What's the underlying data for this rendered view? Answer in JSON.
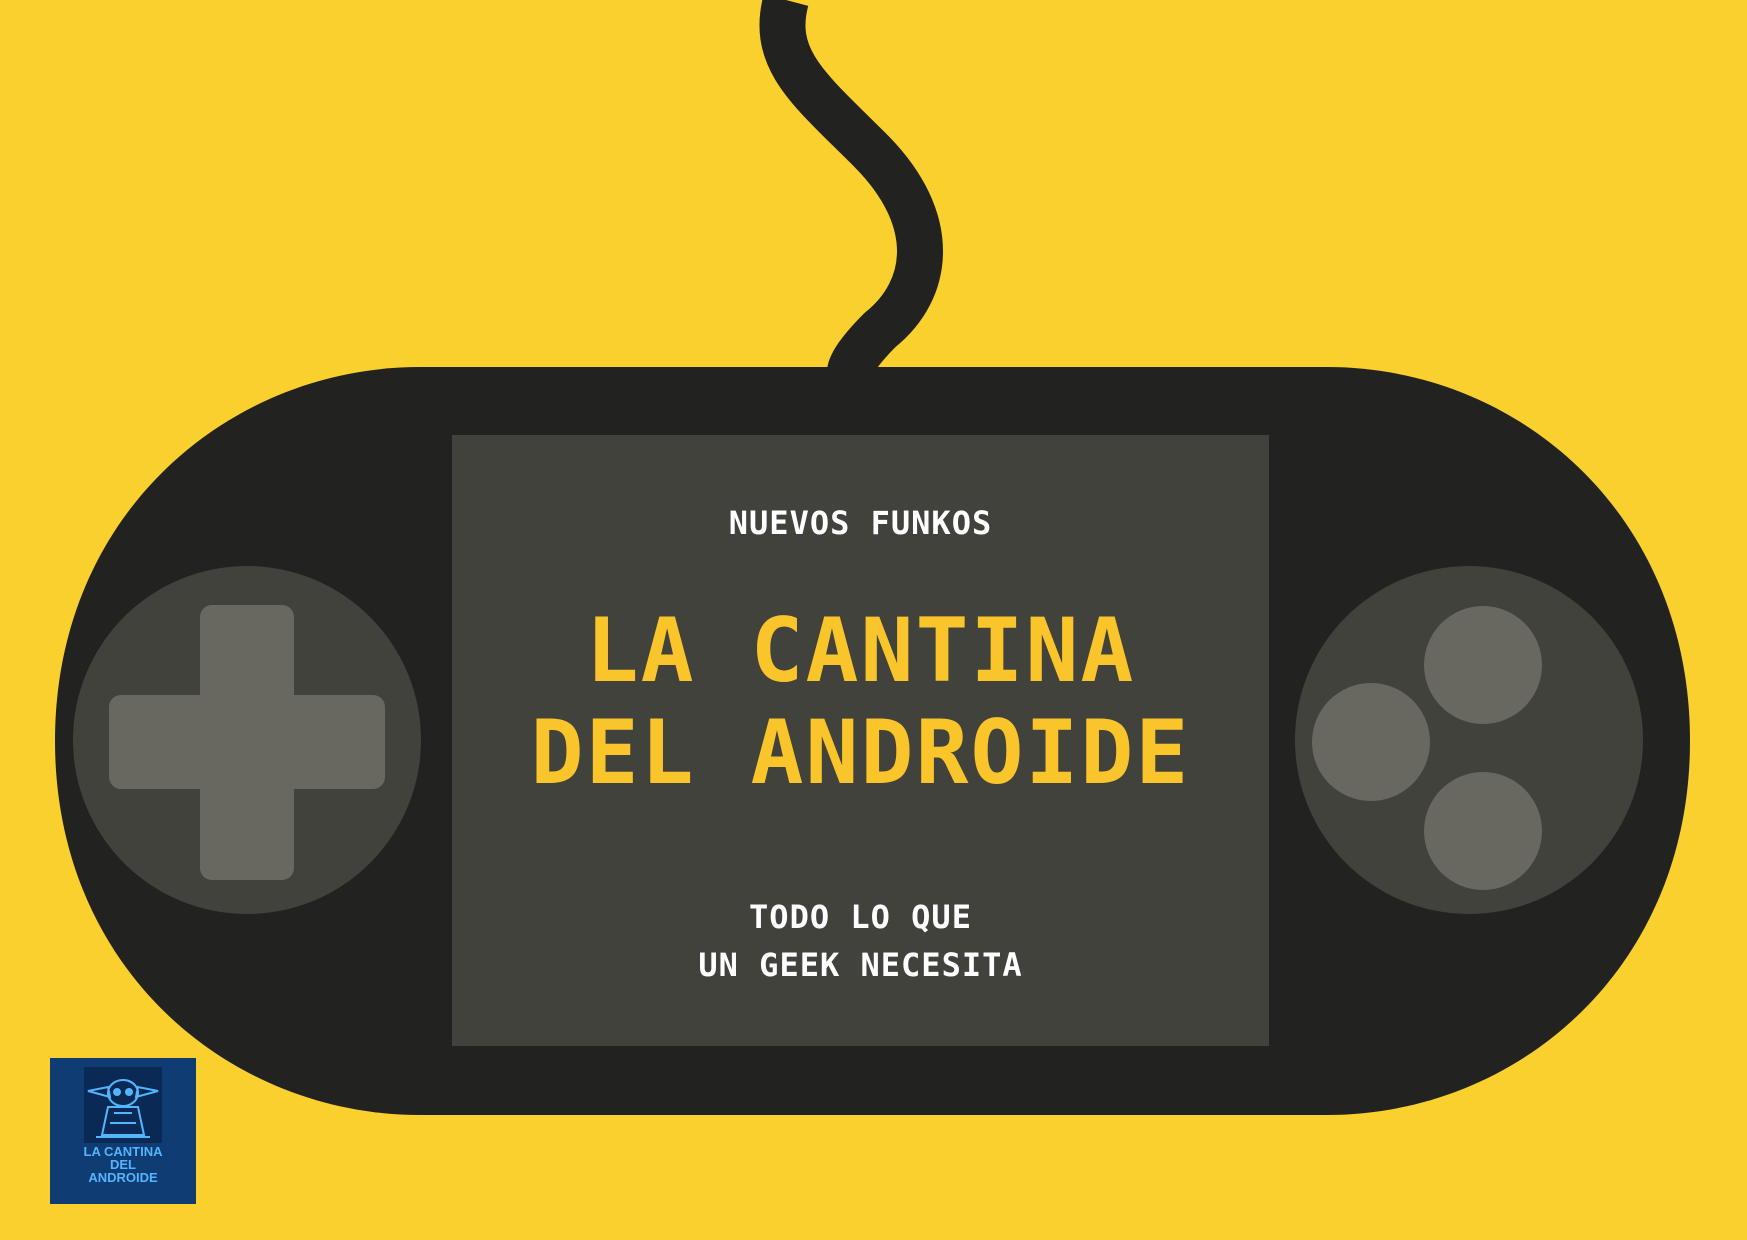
{
  "screen": {
    "subtitle": "NUEVOS FUNKOS",
    "title": "LA CANTINA\nDEL ANDROIDE",
    "tagline": "TODO LO QUE\nUN GEEK NECESITA"
  },
  "logo": {
    "text": "LA CANTINA\nDEL\nANDROIDE"
  },
  "icons": {
    "controller": "gamepad-icon",
    "dpad": "dpad-icon",
    "buttons": "action-buttons-icon",
    "mascot": "alien-mascot-icon"
  },
  "colors": {
    "background": "#f9d02e",
    "controller_body": "#222320",
    "screen": "#42423d",
    "controls_base": "#42423d",
    "controls": "#686860",
    "title": "#f9c52a",
    "text": "#ffffff",
    "logo_background": "#0f3c73",
    "logo_text": "#52b6ff"
  }
}
